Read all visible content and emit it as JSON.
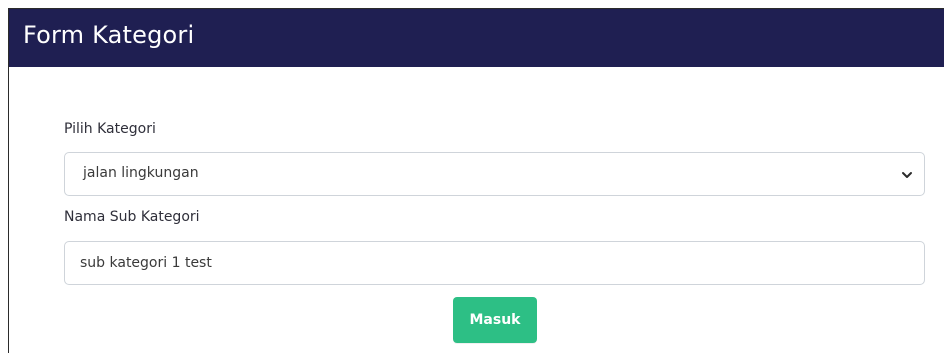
{
  "header": {
    "title": "Form Kategori"
  },
  "form": {
    "kategori": {
      "label": "Pilih Kategori",
      "selected": "jalan lingkungan"
    },
    "sub_kategori": {
      "label": "Nama Sub Kategori",
      "value": "sub kategori 1 test"
    },
    "submit_label": "Masuk"
  },
  "colors": {
    "header_bg": "#1f1f52",
    "button_bg": "#2dbf85",
    "border": "#cfd4da"
  },
  "icons": {
    "select_chevron": "chevron-down-icon"
  }
}
